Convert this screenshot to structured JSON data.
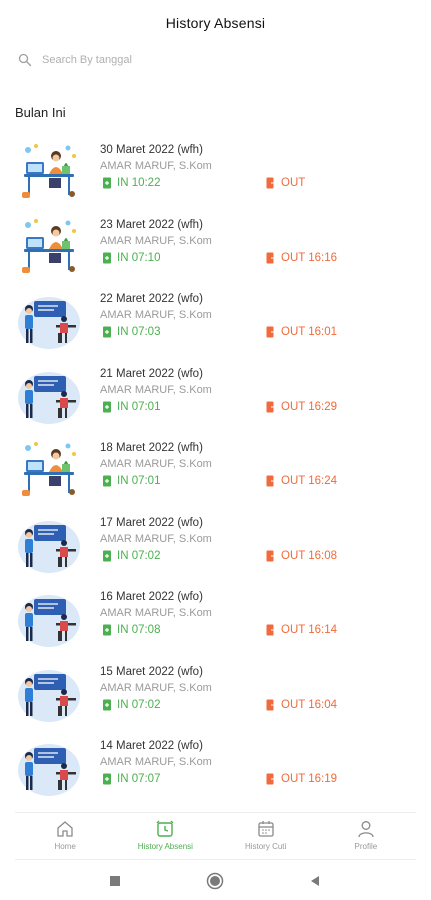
{
  "header": {
    "title": "History Absensi"
  },
  "search": {
    "placeholder": "Search By tanggal"
  },
  "section": {
    "title": "Bulan Ini"
  },
  "records": [
    {
      "date": "30 Maret 2022 (wfh)",
      "name": "AMAR MARUF, S.Kom",
      "in": "IN 10:22",
      "out": "OUT",
      "type": "wfh"
    },
    {
      "date": "23 Maret 2022 (wfh)",
      "name": "AMAR MARUF, S.Kom",
      "in": "IN 07:10",
      "out": "OUT 16:16",
      "type": "wfh"
    },
    {
      "date": "22 Maret 2022 (wfo)",
      "name": "AMAR MARUF, S.Kom",
      "in": "IN 07:03",
      "out": "OUT 16:01",
      "type": "wfo"
    },
    {
      "date": "21 Maret 2022 (wfo)",
      "name": "AMAR MARUF, S.Kom",
      "in": "IN 07:01",
      "out": "OUT 16:29",
      "type": "wfo"
    },
    {
      "date": "18 Maret 2022 (wfh)",
      "name": "AMAR MARUF, S.Kom",
      "in": "IN 07:01",
      "out": "OUT 16:24",
      "type": "wfh"
    },
    {
      "date": "17 Maret 2022 (wfo)",
      "name": "AMAR MARUF, S.Kom",
      "in": "IN 07:02",
      "out": "OUT 16:08",
      "type": "wfo"
    },
    {
      "date": "16 Maret 2022 (wfo)",
      "name": "AMAR MARUF, S.Kom",
      "in": "IN 07:08",
      "out": "OUT 16:14",
      "type": "wfo"
    },
    {
      "date": "15 Maret 2022 (wfo)",
      "name": "AMAR MARUF, S.Kom",
      "in": "IN 07:02",
      "out": "OUT 16:04",
      "type": "wfo"
    },
    {
      "date": "14 Maret 2022 (wfo)",
      "name": "AMAR MARUF, S.Kom",
      "in": "IN 07:07",
      "out": "OUT 16:19",
      "type": "wfo"
    }
  ],
  "nav": [
    {
      "label": "Home",
      "icon": "home-icon",
      "active": false
    },
    {
      "label": "History Absensi",
      "icon": "alarm-clock-icon",
      "active": true
    },
    {
      "label": "History Cuti",
      "icon": "calendar-icon",
      "active": false
    },
    {
      "label": "Profile",
      "icon": "person-icon",
      "active": false
    }
  ],
  "colors": {
    "accent": "#4caf50",
    "in": "#4caf50",
    "out": "#f06a3b",
    "muted": "#9a9a9a"
  },
  "system_nav": [
    "square-icon",
    "circle-icon",
    "back-triangle-icon"
  ]
}
